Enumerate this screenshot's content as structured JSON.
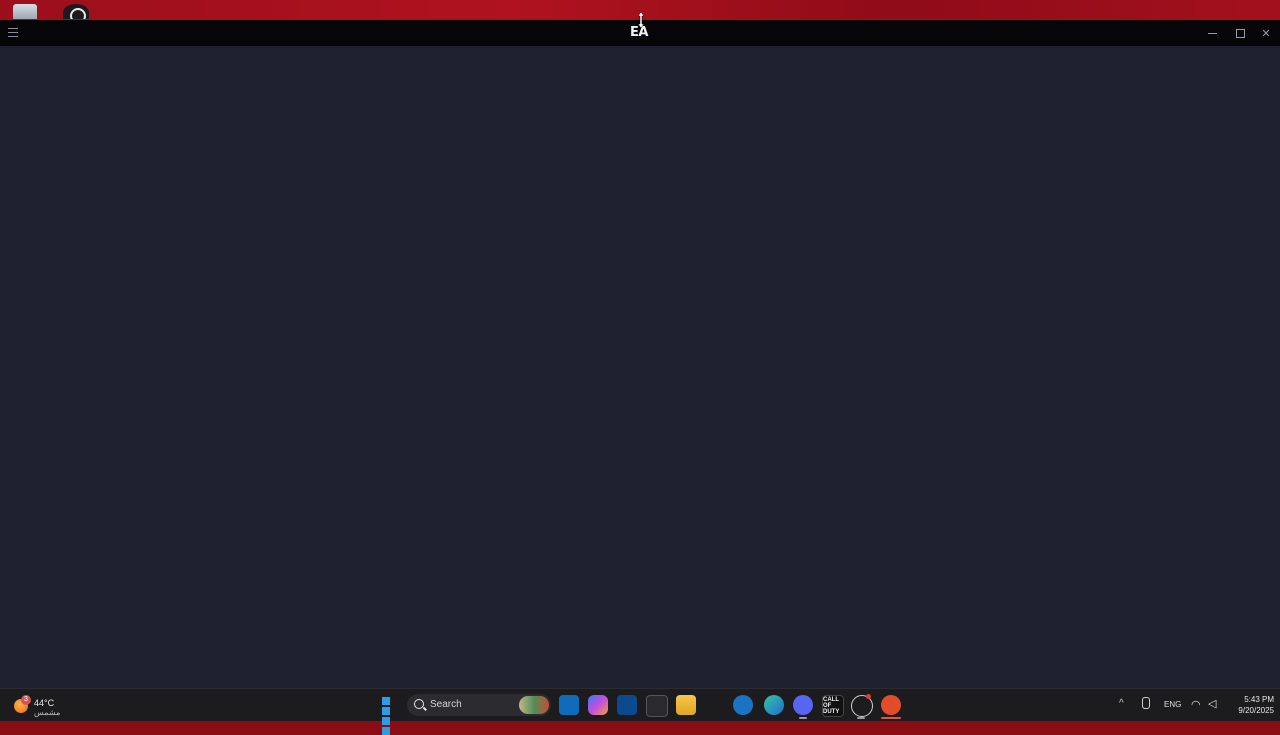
{
  "window": {
    "title": "EA"
  },
  "taskbar": {
    "weather": {
      "badge": "3",
      "temperature": "44°C",
      "condition": "مشمس"
    },
    "search": {
      "placeholder": "Search"
    },
    "apps": [
      {
        "name": "outlook"
      },
      {
        "name": "copilot"
      },
      {
        "name": "defender"
      },
      {
        "name": "microsoft-store"
      },
      {
        "name": "file-explorer"
      },
      {
        "name": "app-blue"
      },
      {
        "name": "edge"
      },
      {
        "name": "discord"
      },
      {
        "name": "call-of-duty",
        "label": "CALL OF DUTY"
      },
      {
        "name": "steam"
      },
      {
        "name": "ea-app"
      }
    ],
    "tray": {
      "language": "ENG",
      "time": "5:43 PM",
      "date": "9/20/2025"
    }
  },
  "colors": {
    "window_bg": "#1e2030",
    "titlebar_bg": "#060609",
    "taskbar_bg": "#1c1c1f",
    "desktop_bg": "#9b0f1c",
    "accent_ea": "#e24c2a"
  }
}
